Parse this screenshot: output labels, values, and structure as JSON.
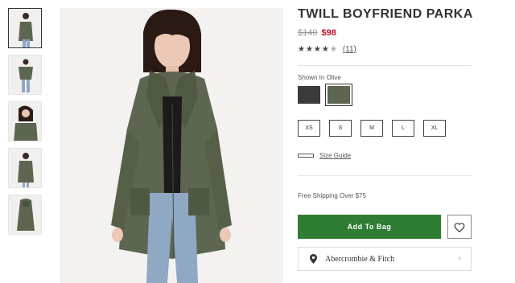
{
  "product": {
    "title": "TWILL BOYFRIEND PARKA",
    "price_original": "$140",
    "price_sale": "$98",
    "rating": 4.5,
    "review_count": "(11)",
    "shown_in_label": "Shown In Olive",
    "colors": [
      {
        "name": "charcoal",
        "hex": "#3b3b3b",
        "selected": false
      },
      {
        "name": "olive",
        "hex": "#5c6650",
        "selected": true
      }
    ],
    "sizes": [
      "XS",
      "S",
      "M",
      "L",
      "XL"
    ],
    "size_guide_label": "Size Guide",
    "shipping_text": "Free Shipping Over $75",
    "add_to_bag_label": "Add To Bag",
    "store_name": "Abercrombie & Fitch"
  },
  "colors": {
    "add_button": "#2e7d32",
    "sale_price": "#c8102e",
    "jacket_olive": "#5c6650"
  },
  "icons": {
    "wishlist": "heart-icon",
    "store": "location-pin-icon",
    "chevron": "chevron-right-icon"
  }
}
